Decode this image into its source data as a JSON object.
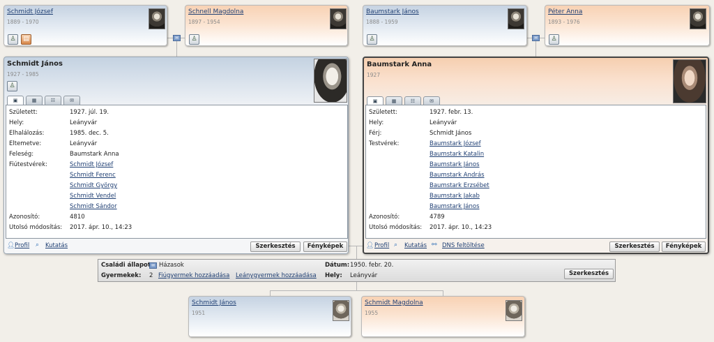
{
  "grandparents": [
    {
      "name": "Schmidt József",
      "years": "1889 - 1970"
    },
    {
      "name": "Schnell Magdolna",
      "years": "1897 - 1954"
    },
    {
      "name": "Baumstark János",
      "years": "1888 - 1959"
    },
    {
      "name": "Péter Anna",
      "years": "1893 - 1976"
    }
  ],
  "husband": {
    "name": "Schmidt János",
    "years": "1927 - 1985",
    "fields": [
      {
        "label": "Született:",
        "value": "1927. júl. 19."
      },
      {
        "label": "Hely:",
        "value": "Leányvár"
      },
      {
        "label": "Elhalálozás:",
        "value": "1985. dec. 5."
      },
      {
        "label": "Eltemetve:",
        "value": "Leányvár"
      },
      {
        "label": "Feleség:",
        "value": "Baumstark Anna"
      }
    ],
    "siblings_label": "Fiútestvérek:",
    "siblings": [
      "Schmidt József",
      "Schmidt Ferenc",
      "Schmidt György",
      "Schmidt Vendel",
      "Schmidt Sándor"
    ],
    "id_label": "Azonosító:",
    "id": "4810",
    "modified_label": "Utolsó módosítás:",
    "modified": "2017. ápr. 10., 14:23",
    "profile_link": "Profil",
    "research_link": "Kutatás",
    "edit_button": "Szerkesztés",
    "photos_button": "Fényképek"
  },
  "wife": {
    "name": "Baumstark Anna",
    "years": "1927",
    "fields": [
      {
        "label": "Született:",
        "value": "1927. febr. 13."
      },
      {
        "label": "Hely:",
        "value": "Leányvár"
      },
      {
        "label": "Férj:",
        "value": "Schmidt János"
      }
    ],
    "siblings_label": "Testvérek:",
    "siblings": [
      "Baumstark József",
      "Baumstark Katalin",
      "Baumstark János",
      "Baumstark András",
      "Baumstark Erzsébet",
      "Baumstark Jakab",
      "Baumstark János"
    ],
    "id_label": "Azonosító:",
    "id": "4789",
    "modified_label": "Utolsó módosítás:",
    "modified": "2017. ápr. 10., 14:23",
    "profile_link": "Profil",
    "research_link": "Kutatás",
    "dna_link": "DNS feltöltése",
    "edit_button": "Szerkesztés",
    "photos_button": "Fényképek"
  },
  "family": {
    "status_label": "Családi állapot:",
    "status": "Házasok",
    "date_label": "Dátum:",
    "date": "1950. febr. 20.",
    "children_label": "Gyermekek:",
    "children_count": "2",
    "add_son": "Fiúgyermek hozzáadása",
    "add_daughter": "Leánygyermek hozzáadása",
    "place_label": "Hely:",
    "place": "Leányvár",
    "edit_button": "Szerkesztés"
  },
  "children": [
    {
      "name": "Schmidt János",
      "years": "1951"
    },
    {
      "name": "Schmidt Magdolna",
      "years": "1955"
    }
  ],
  "colors": {
    "male": "#c6d3e2",
    "female": "#f8d2b4",
    "link": "#1f3f73"
  }
}
